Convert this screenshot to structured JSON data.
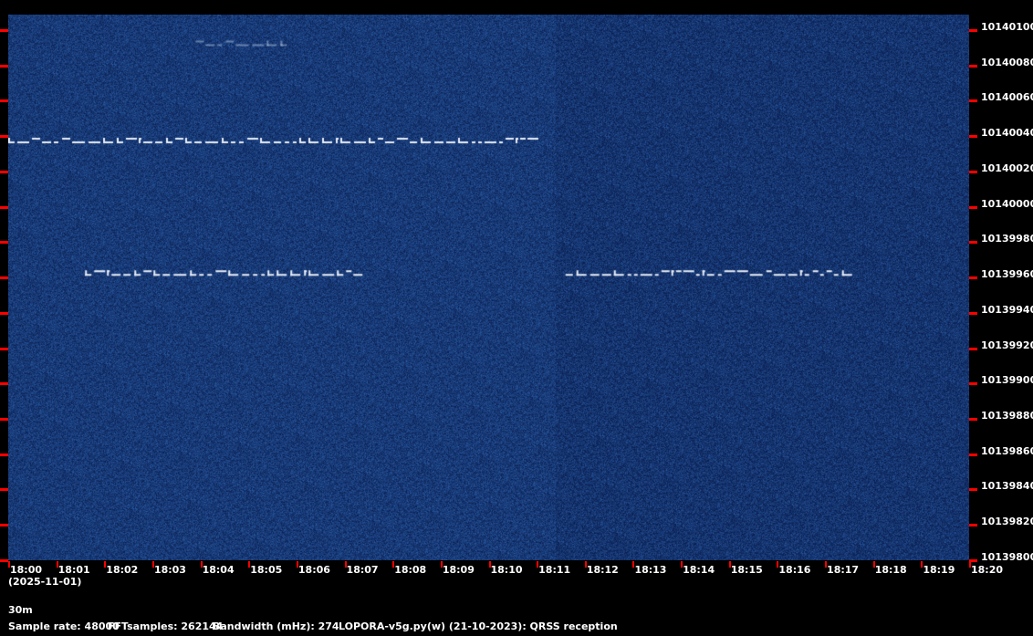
{
  "chart_data": {
    "type": "heatmap",
    "title": "QRSS reception spectrogram",
    "x_ticks": [
      "18:00",
      "18:01",
      "18:02",
      "18:03",
      "18:04",
      "18:05",
      "18:06",
      "18:07",
      "18:08",
      "18:09",
      "18:10",
      "18:11",
      "18:12",
      "18:13",
      "18:14",
      "18:15",
      "18:16",
      "18:17",
      "18:18",
      "18:19",
      "18:20"
    ],
    "y_ticks": [
      "10140100",
      "10140080",
      "10140060",
      "10140040",
      "10140020",
      "10140000",
      "10139980",
      "10139960",
      "10139940",
      "10139920",
      "10139900",
      "10139880",
      "10139860",
      "10139840",
      "10139820",
      "10139800"
    ],
    "xlim_minutes": [
      0,
      20
    ],
    "ylim_hz": [
      10139800,
      10140108
    ],
    "signals": [
      {
        "freq_hz": 10140037,
        "start_min": 0.0,
        "end_min": 11.0
      },
      {
        "freq_hz": 10139962,
        "start_min": 1.6,
        "end_min": 7.4
      },
      {
        "freq_hz": 10139962,
        "start_min": 11.6,
        "end_min": 17.4
      },
      {
        "freq_hz": 10140092,
        "start_min": 3.9,
        "end_min": 5.8
      }
    ],
    "colors": {
      "background_low": "#0a1f55",
      "background_high": "#3a6aa8",
      "signal": "#e8eef8",
      "tick": "#ff0000"
    }
  },
  "footer": {
    "date": "(2025-11-01)",
    "band": "30m",
    "sample_rate": "Sample rate: 48000",
    "fft_samples": "FFTsamples: 262144",
    "bandwidth": "Bandwidth (mHz): 274",
    "software": "LOPORA-v5g.py(w) (21-10-2023): QRSS reception"
  }
}
